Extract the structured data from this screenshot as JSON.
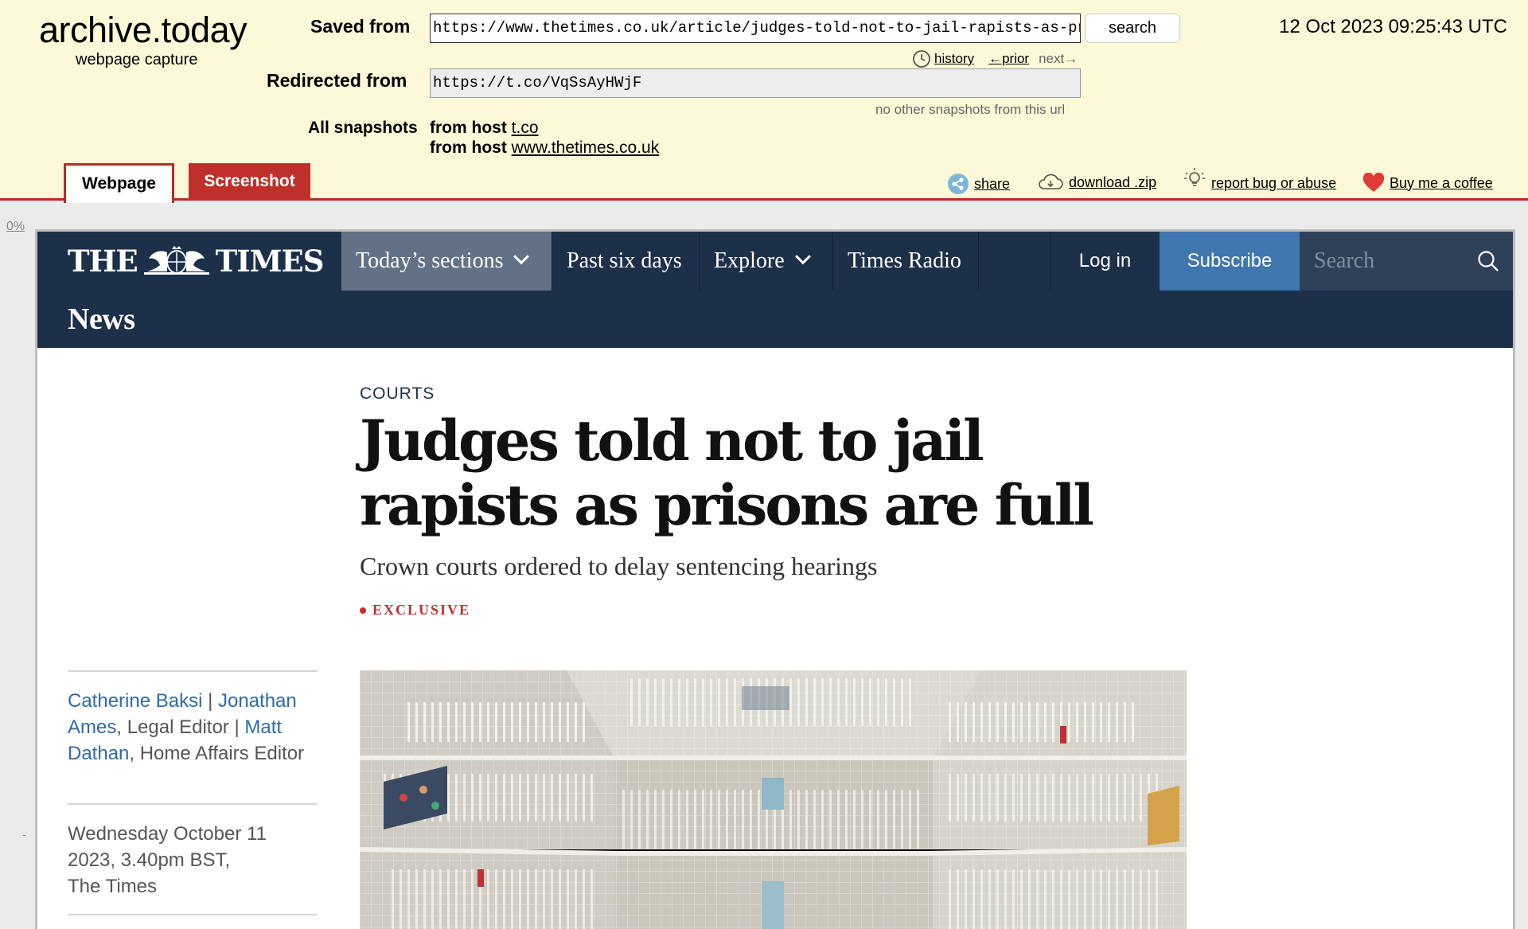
{
  "archive": {
    "logo": "archive.today",
    "sublogo": "webpage capture",
    "saved_from_label": "Saved from",
    "saved_from_url": "https://www.thetimes.co.uk/article/judges-told-not-to-jail-rapists-as-prisons-are-full-",
    "search_label": "search",
    "date": "12 Oct 2023 09:25:43 UTC",
    "history_label": "history",
    "prior_label": "←prior",
    "next_label": "next→",
    "redirected_label": "Redirected from",
    "redirected_url": "https://t.co/VqSsAyHWjF",
    "no_other_snapshots": "no other snapshots from this url",
    "all_snapshots_label": "All snapshots",
    "from_host_label": "from host",
    "host_1": "t.co",
    "host_2": "www.thetimes.co.uk",
    "tabs": {
      "webpage": "Webpage",
      "screenshot": "Screenshot"
    },
    "actions": {
      "share": "share",
      "download": "download .zip",
      "report": "report bug or abuse",
      "coffee": "Buy me a coffee"
    },
    "progress": "0%",
    "side_tick": "-"
  },
  "times": {
    "logo_left": "THE",
    "logo_right": "TIMES",
    "nav": {
      "sections": "Today’s sections",
      "past": "Past six days",
      "explore": "Explore",
      "radio": "Times Radio",
      "login": "Log in",
      "subscribe": "Subscribe",
      "search_placeholder": "Search"
    },
    "subnav": "News"
  },
  "article": {
    "section": "COURTS",
    "headline": "Judges told not to jail rapists as prisons are full",
    "standfirst": "Crown courts ordered to delay sentencing hearings",
    "tag": "EXCLUSIVE",
    "authors": {
      "a1": "Catherine Baksi",
      "sep1": " | ",
      "a2": "Jonathan Ames",
      "role2": ", Legal Editor | ",
      "a3": "Matt Dathan",
      "role3": ", Home Affairs Editor"
    },
    "date_line1": "Wednesday October 11 2023, 3.40pm BST,",
    "date_line2": "The Times"
  }
}
